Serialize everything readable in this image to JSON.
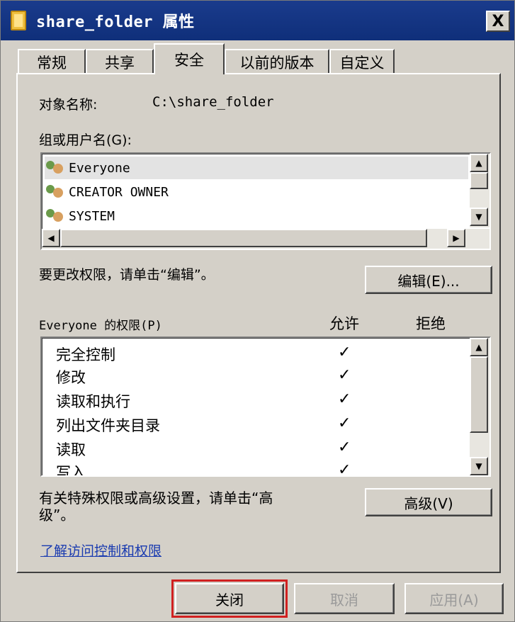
{
  "window": {
    "title": "share_folder 属性",
    "close_glyph": "X"
  },
  "tabs": [
    {
      "label": "常规"
    },
    {
      "label": "共享"
    },
    {
      "label": "安全"
    },
    {
      "label": "以前的版本"
    },
    {
      "label": "自定义"
    }
  ],
  "object": {
    "label": "对象名称:",
    "value": "C:\\share_folder"
  },
  "groups": {
    "label": "组或用户名(G):",
    "items": [
      {
        "name": "Everyone"
      },
      {
        "name": "CREATOR OWNER"
      },
      {
        "name": "SYSTEM"
      }
    ]
  },
  "edit": {
    "hint": "要更改权限，请单击“编辑”。",
    "button": "编辑(E)..."
  },
  "permissions": {
    "header": "Everyone 的权限(P)",
    "allow": "允许",
    "deny": "拒绝",
    "items": [
      {
        "name": "完全控制",
        "allow": "✓"
      },
      {
        "name": "修改",
        "allow": "✓"
      },
      {
        "name": "读取和执行",
        "allow": "✓"
      },
      {
        "name": "列出文件夹目录",
        "allow": "✓"
      },
      {
        "name": "读取",
        "allow": "✓"
      },
      {
        "name": "写入",
        "allow": "✓"
      }
    ]
  },
  "advanced": {
    "hint_line1": "有关特殊权限或高级设置，请单击“高",
    "hint_line2": "级”。",
    "button": "高级(V)"
  },
  "link": "了解访问控制和权限",
  "footer": {
    "close": "关闭",
    "cancel": "取消",
    "apply": "应用(A)"
  },
  "colors": {
    "titlebar": "#0f2f7a",
    "face": "#d4d0c8",
    "link": "#1a3bb0",
    "highlight_box": "#d02020"
  }
}
